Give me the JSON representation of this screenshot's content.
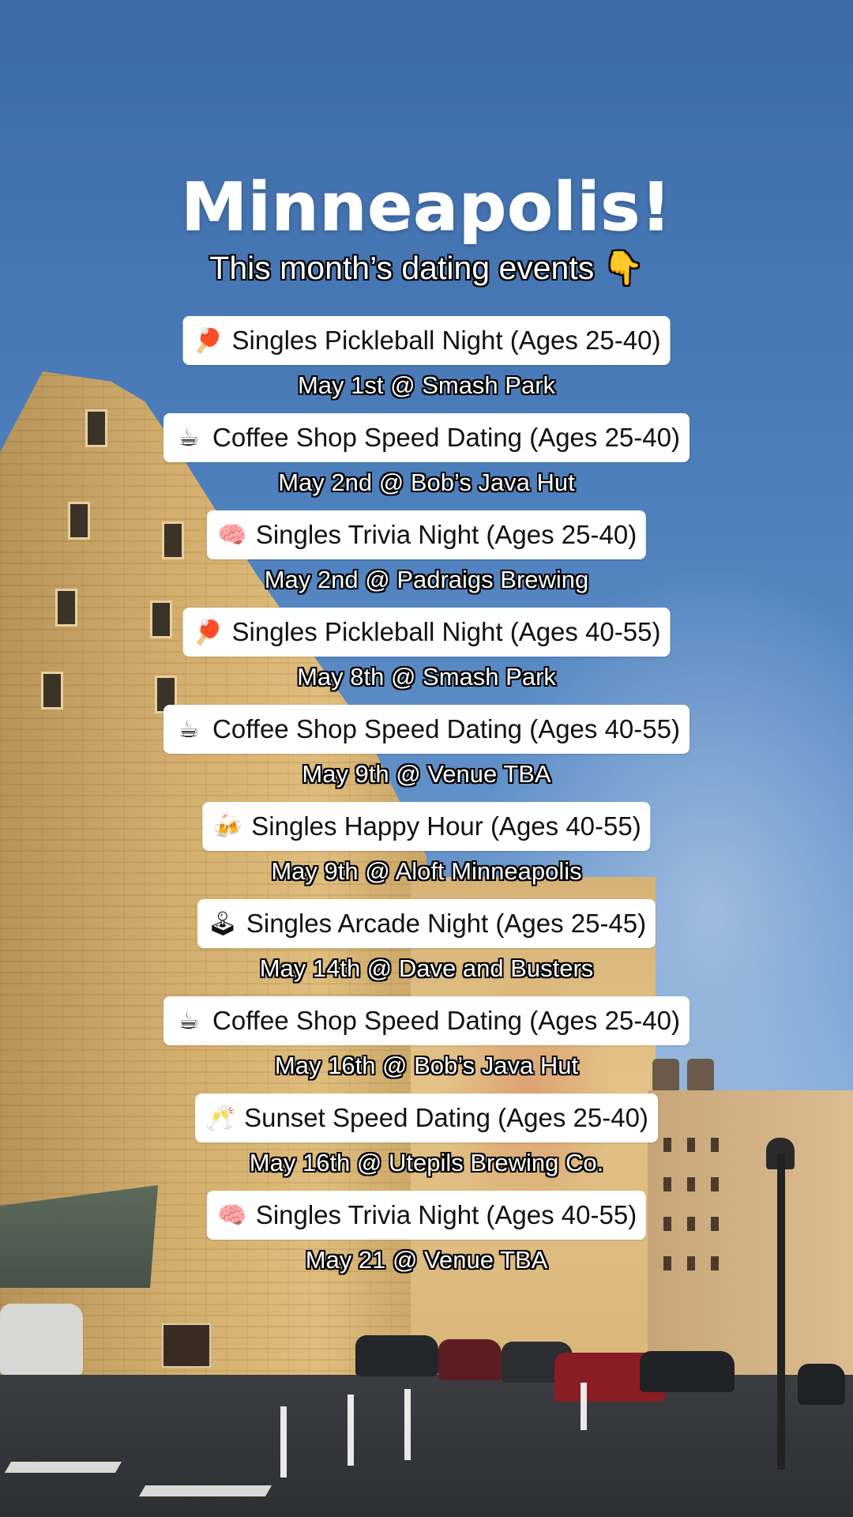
{
  "title": "Minneapolis!",
  "subtitle": "This month’s dating events",
  "subtitle_icon": "hand-pointing-down-icon",
  "subtitle_glyph": "👇",
  "events": [
    {
      "icon": "ping-pong-paddle-icon",
      "glyph": "🏓",
      "name": "Singles Pickleball Night (Ages 25-40)",
      "when_where": "May 1st @ Smash Park"
    },
    {
      "icon": "coffee-cup-icon",
      "glyph": "☕",
      "name": "Coffee Shop Speed Dating (Ages 25-40)",
      "when_where": "May 2nd @ Bob’s Java Hut"
    },
    {
      "icon": "brain-icon",
      "glyph": "🧠",
      "name": "Singles Trivia Night (Ages 25-40)",
      "when_where": "May 2nd @ Padraigs Brewing"
    },
    {
      "icon": "ping-pong-paddle-icon",
      "glyph": "🏓",
      "name": "Singles Pickleball Night (Ages 40-55)",
      "when_where": "May 8th @ Smash Park"
    },
    {
      "icon": "coffee-cup-icon",
      "glyph": "☕",
      "name": "Coffee Shop Speed Dating (Ages 40-55)",
      "when_where": "May 9th @ Venue TBA"
    },
    {
      "icon": "clinking-beer-mugs-icon",
      "glyph": "🍻",
      "name": "Singles Happy Hour (Ages 40-55)",
      "when_where": "May 9th @ Aloft Minneapolis"
    },
    {
      "icon": "joystick-icon",
      "glyph": "🕹",
      "name": "Singles Arcade Night (Ages 25-45)",
      "when_where": "May 14th @ Dave and Busters"
    },
    {
      "icon": "coffee-cup-icon",
      "glyph": "☕",
      "name": "Coffee Shop Speed Dating (Ages 25-40)",
      "when_where": "May 16th @ Bob’s Java Hut"
    },
    {
      "icon": "clinking-glasses-icon",
      "glyph": "🥂",
      "name": "Sunset Speed Dating (Ages 25-40)",
      "when_where": "May 16th @ Utepils Brewing Co."
    },
    {
      "icon": "brain-icon",
      "glyph": "🧠",
      "name": "Singles Trivia Night (Ages 40-55)",
      "when_where": "May 21 @ Venue TBA"
    }
  ]
}
